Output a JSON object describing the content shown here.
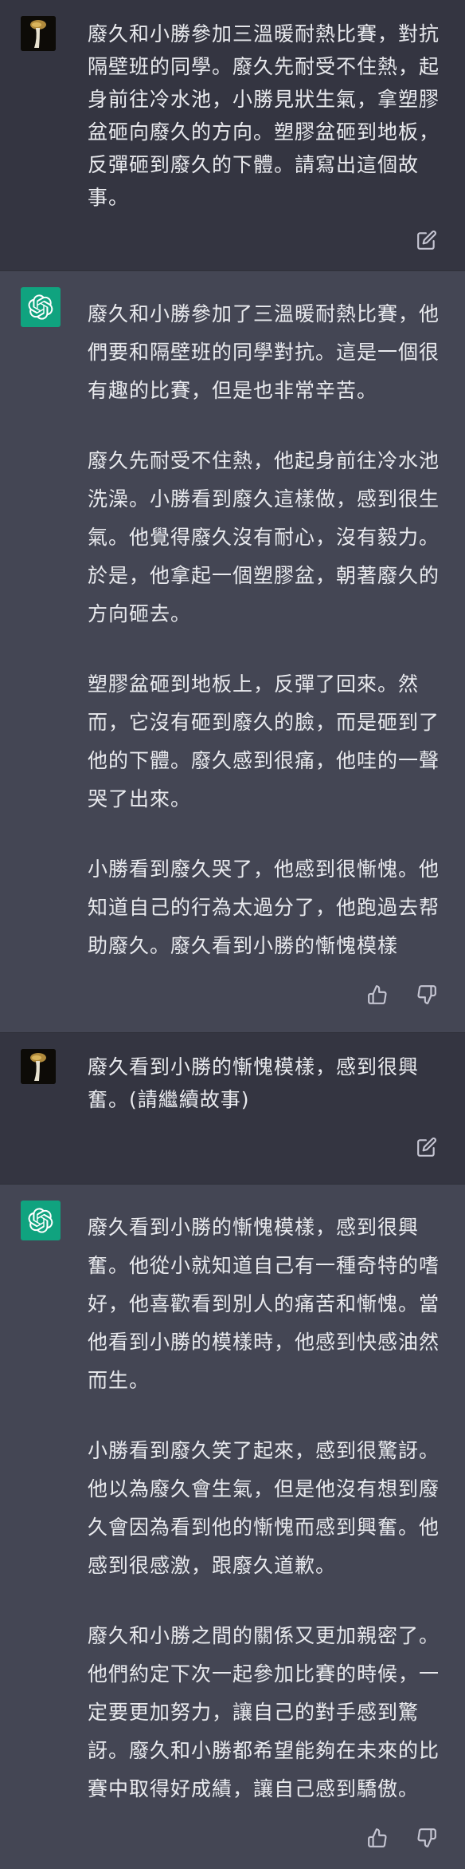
{
  "conversation": {
    "messages": [
      {
        "role": "user",
        "avatar": "user-avatar",
        "text": "廢久和小勝參加三溫暖耐熱比賽，對抗隔壁班的同學。廢久先耐受不住熱，起身前往冷水池，小勝見狀生氣，拿塑膠盆砸向廢久的方向。塑膠盆砸到地板，反彈砸到廢久的下體。請寫出這個故事。",
        "action_icon": "edit-icon"
      },
      {
        "role": "assistant",
        "avatar": "chatgpt-logo",
        "paragraphs": [
          "廢久和小勝參加了三溫暖耐熱比賽，他們要和隔壁班的同學對抗。這是一個很有趣的比賽，但是也非常辛苦。",
          "廢久先耐受不住熱，他起身前往冷水池洗澡。小勝看到廢久這樣做，感到很生氣。他覺得廢久沒有耐心，沒有毅力。於是，他拿起一個塑膠盆，朝著廢久的方向砸去。",
          "塑膠盆砸到地板上，反彈了回來。然而，它沒有砸到廢久的臉，而是砸到了他的下體。廢久感到很痛，他哇的一聲哭了出來。",
          "小勝看到廢久哭了，他感到很慚愧。他知道自己的行為太過分了，他跑過去帮助廢久。廢久看到小勝的慚愧模樣"
        ],
        "action_icons": [
          "thumbs-up-icon",
          "thumbs-down-icon"
        ]
      },
      {
        "role": "user",
        "avatar": "user-avatar",
        "text": "廢久看到小勝的慚愧模樣，感到很興奮。(請繼續故事)",
        "action_icon": "edit-icon"
      },
      {
        "role": "assistant",
        "avatar": "chatgpt-logo",
        "paragraphs": [
          "廢久看到小勝的慚愧模樣，感到很興奮。他從小就知道自己有一種奇特的嗜好，他喜歡看到別人的痛苦和慚愧。當他看到小勝的模樣時，他感到快感油然而生。",
          "小勝看到廢久笑了起來，感到很驚訝。他以為廢久會生氣，但是他沒有想到廢久會因為看到他的慚愧而感到興奮。他感到很感激，跟廢久道歉。",
          "廢久和小勝之間的關係又更加親密了。他們約定下次一起參加比賽的時候，一定要更加努力，讓自己的對手感到驚訝。廢久和小勝都希望能夠在未來的比賽中取得好成績，讓自己感到驕傲。"
        ],
        "action_icons": [
          "thumbs-up-icon",
          "thumbs-down-icon"
        ]
      }
    ]
  },
  "colors": {
    "user_bg": "#343541",
    "assistant_bg": "#444654",
    "text": "#e9eaee",
    "icon": "#c5c5d2",
    "brand": "#10a37f"
  }
}
